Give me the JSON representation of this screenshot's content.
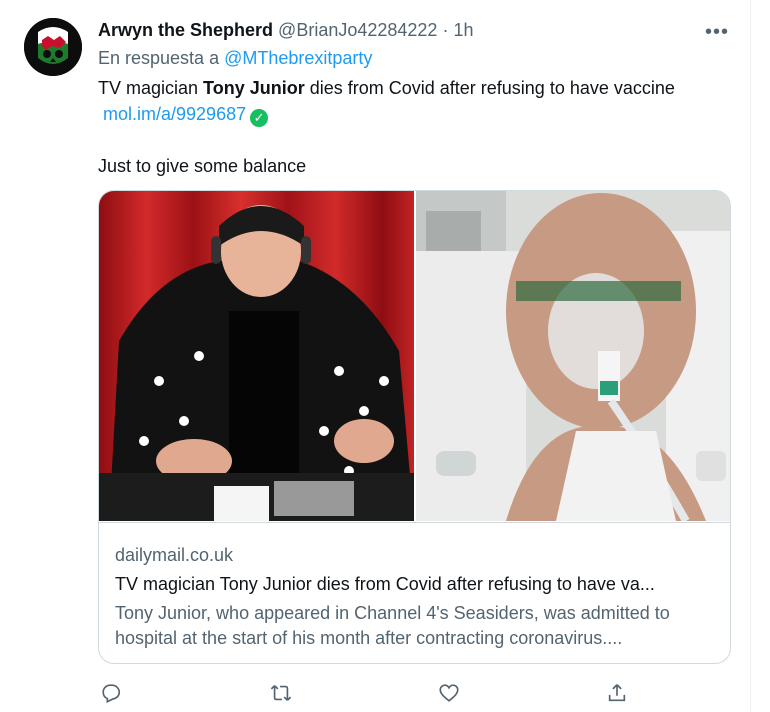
{
  "tweet": {
    "author_name": "Arwyn the Shepherd",
    "author_handle": "@BrianJo42284222",
    "separator": "·",
    "time": "1h",
    "more_label": "•••",
    "reply_prefix": "En respuesta a",
    "reply_mention": "@MThebrexitparty",
    "text_part1": "TV magician ",
    "text_bold": "Tony Junior",
    "text_part2": " dies from Covid after refusing to have vaccine",
    "link": "mol.im/a/9929687",
    "check_glyph": "✓",
    "second_line": "Just to give some balance"
  },
  "card": {
    "domain": "dailymail.co.uk",
    "title": "TV magician Tony Junior dies from Covid after refusing to have va...",
    "description": "Tony Junior, who appeared in Channel 4's Seasiders, was admitted to hospital at the start of his month after contracting coronavirus...."
  },
  "actions": [
    "reply-icon",
    "retweet-icon",
    "like-icon",
    "share-icon"
  ],
  "colors": {
    "accent": "#1d9bf0",
    "muted": "#536471",
    "border": "#cfd9de",
    "verified": "#17bf63"
  }
}
